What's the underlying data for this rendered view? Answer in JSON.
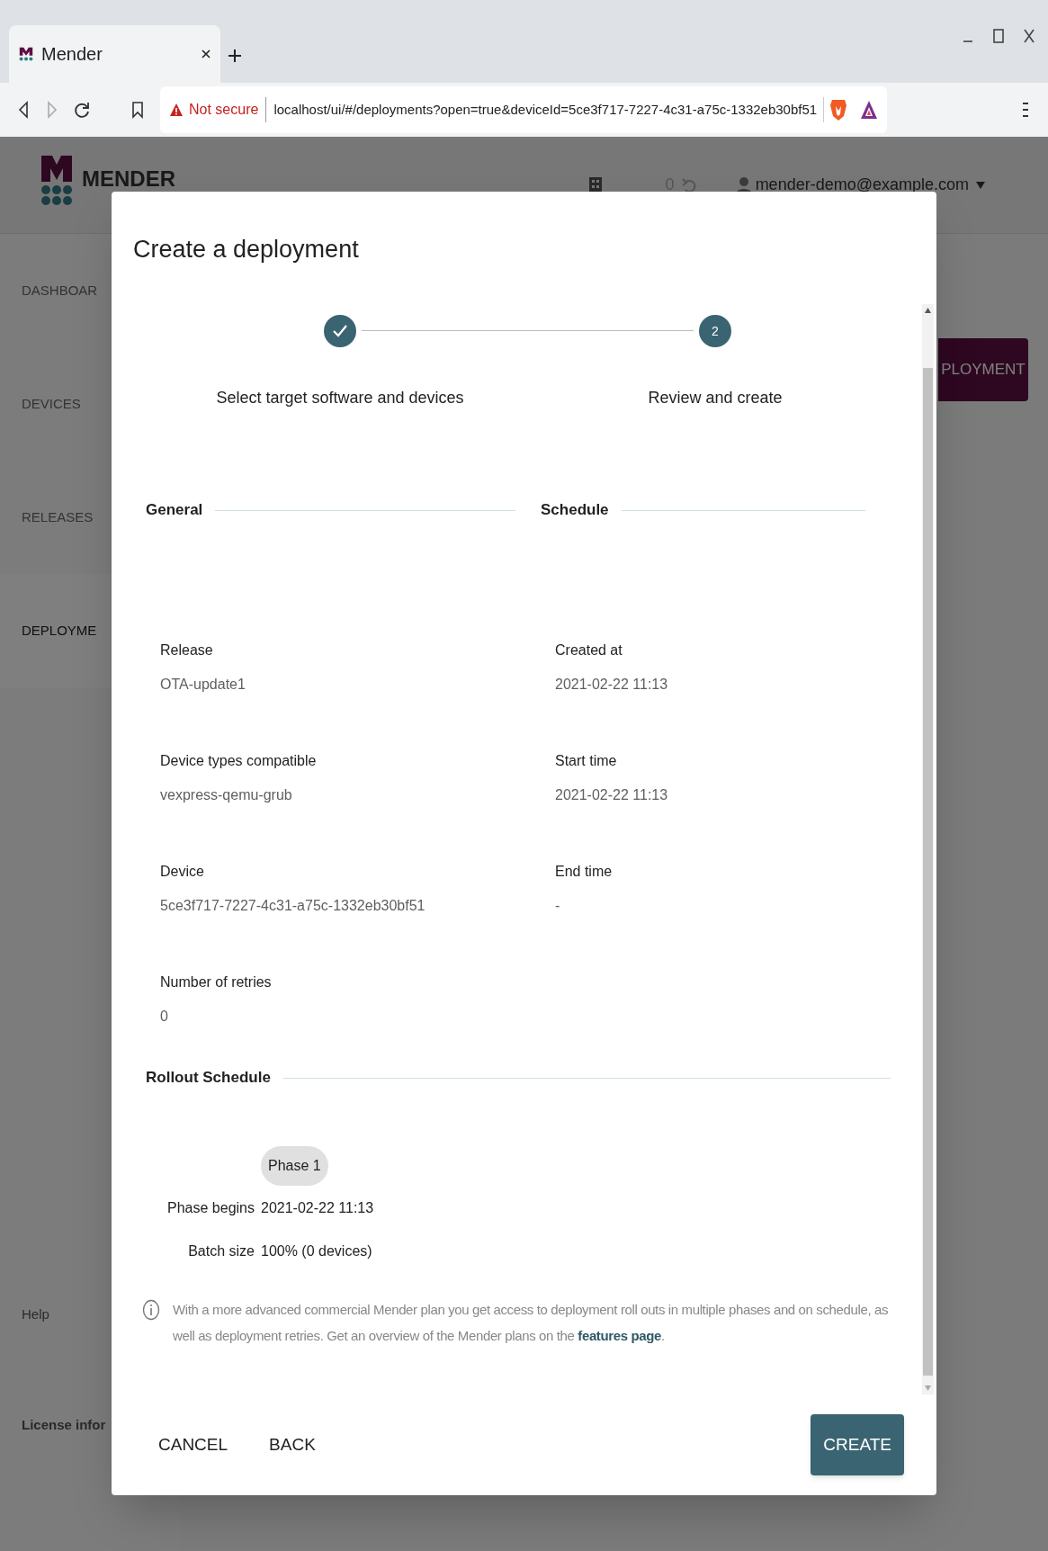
{
  "browser": {
    "tab": {
      "title": "Mender"
    },
    "address": {
      "security": "Not secure",
      "url": "localhost/ui/#/deployments?open=true&deviceId=5ce3f717-7227-4c31-a75c-1332eb30bf51"
    }
  },
  "app": {
    "logo_text": "MENDER",
    "header": {
      "pending_count": "0",
      "user": "mender-demo@example.com"
    },
    "sidebar": {
      "items": [
        {
          "label": "DASHBOAR",
          "selected": false
        },
        {
          "label": "DEVICES",
          "selected": false
        },
        {
          "label": "RELEASES",
          "selected": false
        },
        {
          "label": "DEPLOYME",
          "selected": true
        }
      ],
      "footer_links": [
        {
          "label": "Help",
          "bold": false
        },
        {
          "label": "License infor",
          "bold": true
        }
      ]
    },
    "page_button": "PLOYMENT"
  },
  "dialog": {
    "title": "Create a deployment",
    "steps": [
      {
        "label": "Select target software and devices",
        "completed": true
      },
      {
        "label": "Review and create",
        "number": "2",
        "completed": false
      }
    ],
    "sections": [
      {
        "title": "General",
        "fields": [
          {
            "label": "Release",
            "value": "OTA-update1"
          },
          {
            "label": "Device types compatible",
            "value": "vexpress-qemu-grub"
          },
          {
            "label": "Device",
            "value": "5ce3f717-7227-4c31-a75c-1332eb30bf51"
          },
          {
            "label": "Number of retries",
            "value": "0"
          }
        ]
      },
      {
        "title": "Schedule",
        "fields": [
          {
            "label": "Created at",
            "value": "2021-02-22 11:13"
          },
          {
            "label": "Start time",
            "value": "2021-02-22 11:13"
          },
          {
            "label": "End time",
            "value": "-"
          }
        ]
      }
    ],
    "rollout": {
      "title": "Rollout Schedule",
      "phase": "Phase 1",
      "rows": [
        {
          "label": "Phase begins",
          "value": "2021-02-22 11:13"
        },
        {
          "label": "Batch size",
          "value": "100% (0 devices)"
        }
      ],
      "info": {
        "text": "With a more advanced commercial Mender plan you get access to deployment roll outs in multiple phases and on schedule, as well as deployment retries. Get an overview of the Mender plans on the ",
        "link": "features page",
        "after": "."
      }
    },
    "buttons": {
      "cancel": "CANCEL",
      "back": "BACK",
      "create": "CREATE"
    }
  }
}
